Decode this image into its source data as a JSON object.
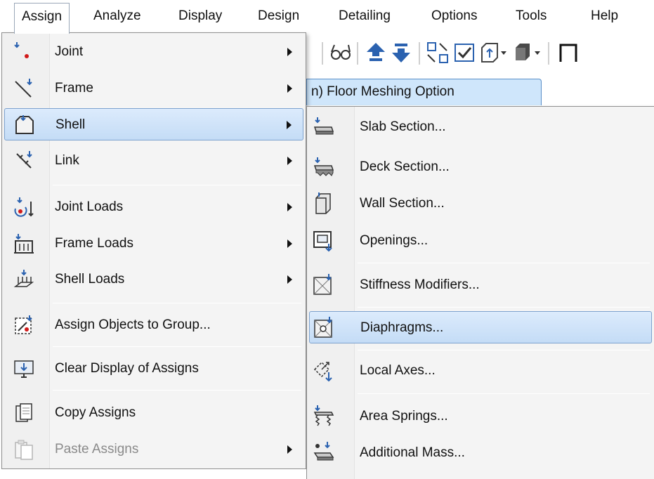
{
  "menubar": {
    "items": [
      "Assign",
      "Analyze",
      "Display",
      "Design",
      "Detailing",
      "Options",
      "Tools",
      "Help"
    ]
  },
  "tab": {
    "label": "n) Floor Meshing Option"
  },
  "assign_menu": {
    "items": [
      {
        "label": "Joint",
        "icon": "joint-icon",
        "submenu": true
      },
      {
        "label": "Frame",
        "icon": "frame-icon",
        "submenu": true
      },
      {
        "label": "Shell",
        "icon": "shell-icon",
        "submenu": true
      },
      {
        "label": "Link",
        "icon": "link-icon",
        "submenu": true
      },
      {
        "label": "Joint Loads",
        "icon": "joint-loads-icon",
        "submenu": true
      },
      {
        "label": "Frame Loads",
        "icon": "frame-loads-icon",
        "submenu": true
      },
      {
        "label": "Shell Loads",
        "icon": "shell-loads-icon",
        "submenu": true
      },
      {
        "label": "Assign Objects to Group...",
        "icon": "group-icon",
        "submenu": false
      },
      {
        "label": "Clear Display of Assigns",
        "icon": "clear-display-icon",
        "submenu": false
      },
      {
        "label": "Copy Assigns",
        "icon": "copy-icon",
        "submenu": false
      },
      {
        "label": "Paste Assigns",
        "icon": "paste-icon",
        "submenu": true,
        "disabled": true
      }
    ]
  },
  "shell_menu": {
    "items": [
      {
        "label": "Slab Section...",
        "icon": "slab-section-icon"
      },
      {
        "label": "Deck Section...",
        "icon": "deck-section-icon"
      },
      {
        "label": "Wall Section...",
        "icon": "wall-section-icon"
      },
      {
        "label": "Openings...",
        "icon": "openings-icon"
      },
      {
        "label": "Stiffness Modifiers...",
        "icon": "stiffness-modifiers-icon"
      },
      {
        "label": "Diaphragms...",
        "icon": "diaphragms-icon"
      },
      {
        "label": "Local Axes...",
        "icon": "local-axes-icon"
      },
      {
        "label": "Area Springs...",
        "icon": "area-springs-icon"
      },
      {
        "label": "Additional Mass...",
        "icon": "additional-mass-icon"
      }
    ]
  },
  "colors": {
    "highlight_top": "#dcebfc",
    "highlight_bottom": "#c4dcf6",
    "highlight_border": "#7da2ce",
    "tab_fill": "#cfe6fb",
    "icon_blue": "#2b62b0",
    "icon_red": "#d11a1a"
  }
}
